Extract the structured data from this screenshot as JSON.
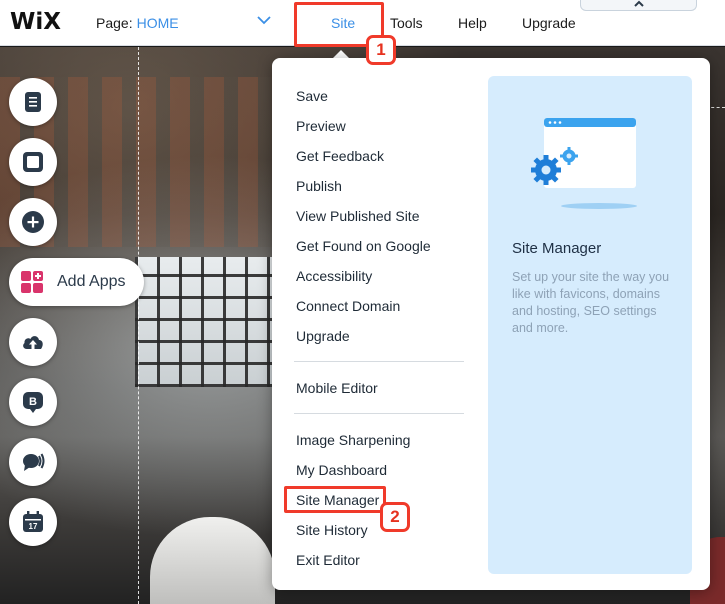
{
  "header": {
    "logo": "WiX",
    "page_label": "Page:",
    "page_value": "HOME",
    "nav": {
      "site": "Site",
      "tools": "Tools",
      "help": "Help",
      "upgrade": "Upgrade"
    }
  },
  "annotations": {
    "step1": "1",
    "step2": "2",
    "highlight_color": "#f03a2a"
  },
  "sidebar": {
    "add_apps_label": "Add Apps",
    "icons": [
      "pages-icon",
      "background-icon",
      "add-icon",
      "add-apps-icon",
      "upload-icon",
      "blog-icon",
      "chat-icon",
      "bookings-icon"
    ]
  },
  "site_menu": {
    "group1": [
      "Save",
      "Preview",
      "Get Feedback",
      "Publish",
      "View Published Site",
      "Get Found on Google",
      "Accessibility",
      "Connect Domain",
      "Upgrade"
    ],
    "group2": [
      "Mobile Editor"
    ],
    "group3": [
      "Image Sharpening",
      "My Dashboard",
      "Site Manager",
      "Site History",
      "Exit Editor"
    ],
    "panel": {
      "title": "Site Manager",
      "description": "Set up your site the way you like with favicons, domains and hosting, SEO settings and more."
    }
  },
  "colors": {
    "accent": "#3b8fe6",
    "panel_bg": "#d6ecfd",
    "text_dark": "#1e2a36"
  }
}
